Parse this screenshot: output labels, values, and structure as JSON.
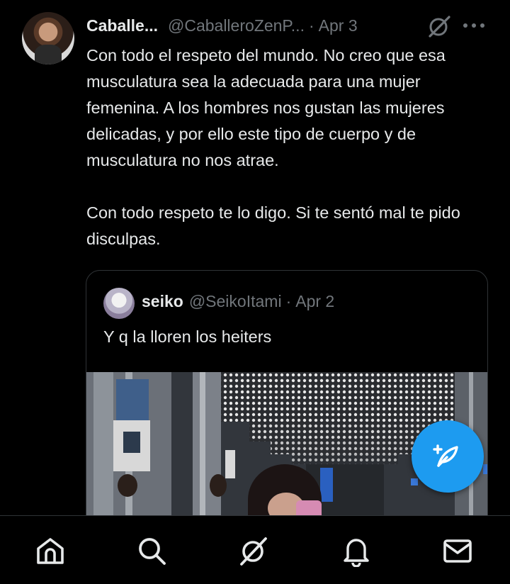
{
  "tweet": {
    "author_name": "Caballe...",
    "author_handle": "@CaballeroZenP...",
    "separator": "·",
    "date": "Apr 3",
    "paragraphs": [
      "Con todo el respeto del mundo. No creo que esa musculatura sea la adecuada para una mujer femenina. A los hombres nos gustan las mujeres delicadas, y por ello este tipo de cuerpo y de musculatura no nos atrae.",
      "Con todo respeto te lo digo. Si te sentó mal te pido disculpas."
    ]
  },
  "quoted_tweet": {
    "author_name": "seiko",
    "author_handle": "@SeikoItami",
    "date": "Apr 2",
    "text": "Y q la lloren los heiters"
  },
  "icons": {
    "grok": "grok-icon",
    "more": "more-icon",
    "compose": "compose-icon",
    "nav": [
      "home-icon",
      "search-icon",
      "grok-icon",
      "notifications-icon",
      "messages-icon"
    ]
  },
  "colors": {
    "background": "#000000",
    "text_primary": "#e7e9ea",
    "text_secondary": "#71767b",
    "accent": "#1d9bf0",
    "border": "#2f3336"
  }
}
